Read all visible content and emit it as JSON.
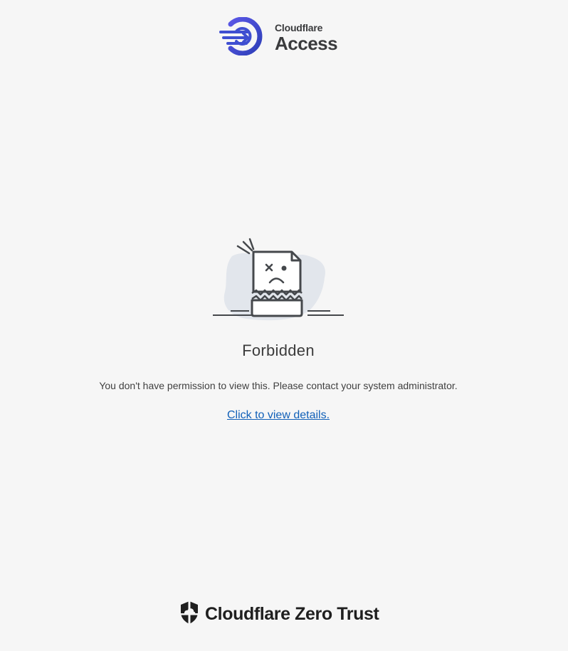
{
  "header": {
    "brand_small": "Cloudflare",
    "brand_large": "Access",
    "icon": "cloudflare-access-icon"
  },
  "main": {
    "illustration": "broken-document-illustration",
    "title": "Forbidden",
    "message": "You don't have permission to view this. Please contact your system administrator.",
    "details_link": "Click to view details."
  },
  "footer": {
    "brand": "Cloudflare Zero Trust",
    "icon": "cloudflare-shield-icon"
  },
  "colors": {
    "background": "#f6f6f6",
    "brand_blue": "#3f4fd1",
    "link": "#1160b8",
    "text": "#404040"
  }
}
